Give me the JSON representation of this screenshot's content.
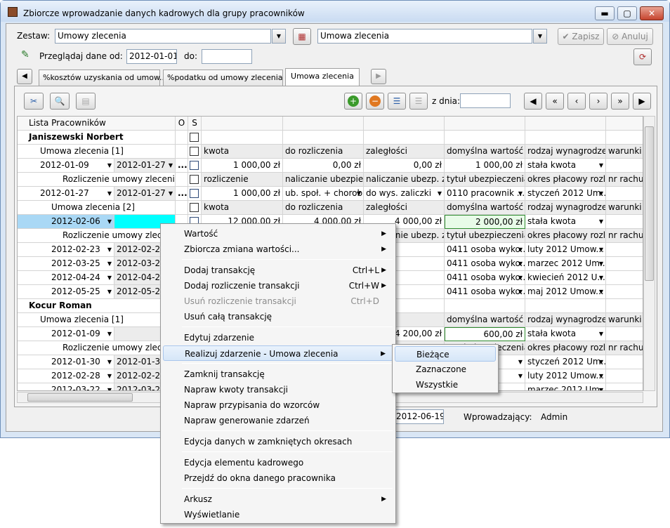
{
  "window": {
    "title": "Zbiorcze wprowadzanie danych kadrowych dla grupy pracowników",
    "minimize": "▬",
    "maximize": "▢",
    "close": "✕"
  },
  "form": {
    "zestaw_label": "Zestaw:",
    "zestaw_value": "Umowy zlecenia",
    "zestaw2_value": "Umowa zlecenia",
    "zapisz": "Zapisz",
    "anuluj": "Anuluj",
    "przegladaj_label": "Przeglądaj dane od:",
    "date_from": "2012-01-01",
    "do_label": "do:",
    "date_to": ""
  },
  "tabs": [
    "%kosztów uzyskania od umow...",
    "%podatku od umowy zlecenia",
    "Umowa zlecenia"
  ],
  "toolbar": {
    "z_dnia_label": "z dnia:",
    "z_dnia_value": "",
    "nav": [
      "◀",
      "«",
      "‹",
      "›",
      "»",
      "▶"
    ]
  },
  "grid": {
    "header": {
      "lista": "Lista Pracowników",
      "o": "O",
      "s": "S"
    },
    "rows": [
      {
        "a": "Janiszewski Norbert",
        "b": "",
        "bold": true,
        "c": [
          "",
          "",
          "",
          "",
          "",
          ""
        ]
      },
      {
        "a": "Umowa zlecenia [1]",
        "b": "",
        "c": [
          "kwota",
          "do rozliczenia",
          "zaległości",
          "domyślna wartość ...",
          "rodzaj wynagrodze...",
          "warunki w"
        ]
      },
      {
        "a": "2012-01-09",
        "b": "2012-01-27",
        "dots": true,
        "c": [
          "1 000,00 zł",
          "0,00 zł",
          "0,00 zł",
          "1 000,00 zł",
          "stała kwota",
          ""
        ]
      },
      {
        "a": "Rozliczenie umowy zlecenia",
        "b": "",
        "c": [
          "rozliczenie",
          "naliczanie ubezpiec...",
          "naliczanie ubezp. z...",
          "tytuł ubezpieczenia",
          "okres płacowy rozli...",
          "nr rachur"
        ]
      },
      {
        "a": "2012-01-27",
        "b": "2012-01-27",
        "dots": true,
        "c": [
          "1 000,00 zł",
          "ub. społ. + chorob",
          "do wys. zaliczki",
          "0110 pracownik ...",
          "styczeń 2012 Um...",
          ""
        ]
      },
      {
        "a": "Umowa zlecenia [2]",
        "b": "",
        "c": [
          "kwota",
          "do rozliczenia",
          "zaległości",
          "domyślna wartość ...",
          "rodzaj wynagrodze...",
          "warunki w"
        ]
      },
      {
        "a": "2012-02-06",
        "b": "",
        "sel": true,
        "c": [
          "12 000,00 zł",
          "4 000,00 zł",
          "4 000,00 zł",
          "2 000,00 zł",
          "stała kwota",
          ""
        ]
      },
      {
        "a": "Rozliczenie umowy zlecenia",
        "b": "",
        "c": [
          "",
          "",
          "naliczanie ubezp. z...",
          "tytuł ubezpieczenia",
          "okres płacowy rozli...",
          "nr rachur"
        ]
      },
      {
        "a": "2012-02-23",
        "b": "2012-02-23",
        "c": [
          "",
          "",
          "zaliczki",
          "0411 osoba wyko...",
          "luty 2012 Umow...",
          ""
        ]
      },
      {
        "a": "2012-03-25",
        "b": "2012-03-25",
        "c": [
          "",
          "",
          "zaliczki",
          "0411 osoba wyko...",
          "marzec 2012 Um...",
          ""
        ]
      },
      {
        "a": "2012-04-24",
        "b": "2012-04-24",
        "c": [
          "",
          "",
          "zaliczki",
          "0411 osoba wyko...",
          "kwiecień 2012 U...",
          ""
        ]
      },
      {
        "a": "2012-05-25",
        "b": "2012-05-25",
        "c": [
          "",
          "",
          "zaliczki",
          "0411 osoba wyko...",
          "maj 2012 Umow...",
          ""
        ]
      },
      {
        "a": "Kocur Roman",
        "b": "",
        "bold": true,
        "c": [
          "",
          "",
          "",
          "",
          "",
          ""
        ]
      },
      {
        "a": "Umowa zlecenia [1]",
        "b": "",
        "c": [
          "",
          "",
          "ści",
          "domyślna wartość ...",
          "rodzaj wynagrodze...",
          "warunki w"
        ]
      },
      {
        "a": "2012-01-09",
        "b": "",
        "c": [
          "",
          "",
          "4 200,00 zł",
          "600,00 zł",
          "stała kwota",
          ""
        ]
      },
      {
        "a": "Rozliczenie umowy zlecenia",
        "b": "",
        "c": [
          "",
          "",
          "",
          "tytuł ubezpieczenia",
          "okres płacowy rozli...",
          "nr rachur"
        ]
      },
      {
        "a": "2012-01-30",
        "b": "2012-01-30",
        "c": [
          "",
          "",
          "",
          "ik ...",
          "styczeń 2012 Um...",
          ""
        ]
      },
      {
        "a": "2012-02-28",
        "b": "2012-02-28",
        "c": [
          "",
          "",
          "",
          "ik ...",
          "luty 2012 Umow...",
          ""
        ]
      },
      {
        "a": "2012-03-22",
        "b": "2012-03-22",
        "c": [
          "",
          "",
          "",
          "",
          "marzec 2012 Um...",
          ""
        ]
      }
    ]
  },
  "footer": {
    "date": "2012-06-19",
    "wprowadzajacy_label": "Wprowadzający:",
    "wprowadzajacy_value": "Admin"
  },
  "context_menu": {
    "items": [
      {
        "label": "Wartość",
        "arrow": "▶"
      },
      {
        "label": "Zbiorcza zmiana wartości...",
        "arrow": "▶"
      },
      {
        "label": "Dodaj transakcję",
        "shortcut": "Ctrl+L",
        "arrow": "▶"
      },
      {
        "label": "Dodaj rozliczenie transakcji",
        "shortcut": "Ctrl+W",
        "arrow": "▶"
      },
      {
        "label": "Usuń rozliczenie transakcji",
        "shortcut": "Ctrl+D",
        "disabled": true
      },
      {
        "label": "Usuń całą transakcję"
      },
      {
        "label": "Edytuj zdarzenie"
      },
      {
        "label": "Realizuj zdarzenie - Umowa zlecenia",
        "arrow": "▶",
        "highlight": true
      },
      {
        "label": "Zamknij transakcję"
      },
      {
        "label": "Napraw kwoty transakcji"
      },
      {
        "label": "Napraw przypisania do wzorców"
      },
      {
        "label": "Napraw generowanie zdarzeń"
      },
      {
        "label": "Edycja danych w zamkniętych okresach"
      },
      {
        "label": "Edycja elementu kadrowego"
      },
      {
        "label": "Przejdź do okna danego pracownika"
      },
      {
        "label": "Arkusz",
        "arrow": "▶"
      },
      {
        "label": "Wyświetlanie"
      }
    ]
  },
  "submenu": {
    "items": [
      "Bieżące",
      "Zaznaczone",
      "Wszystkie"
    ]
  }
}
